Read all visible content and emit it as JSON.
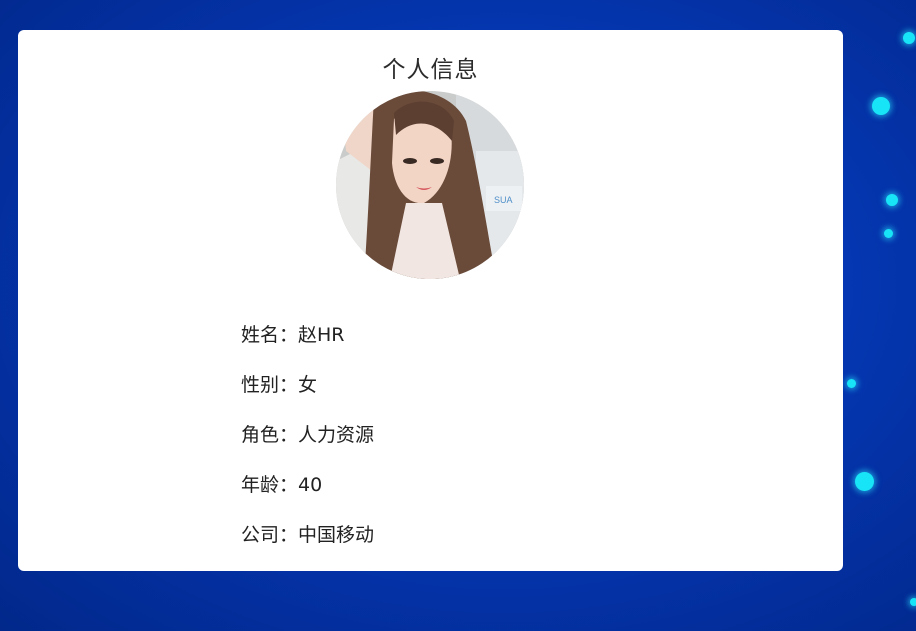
{
  "page": {
    "title": "个人信息"
  },
  "avatar": {
    "icon": "profile-photo"
  },
  "profile": [
    {
      "label": "姓名：",
      "value": "赵HR"
    },
    {
      "label": "性别：",
      "value": "女"
    },
    {
      "label": "角色：",
      "value": "人力资源"
    },
    {
      "label": "年龄：",
      "value": "40"
    },
    {
      "label": "公司：",
      "value": "中国移动"
    }
  ],
  "colors": {
    "background": "#0538b5",
    "card": "#ffffff",
    "dot": "#18e4f7"
  }
}
